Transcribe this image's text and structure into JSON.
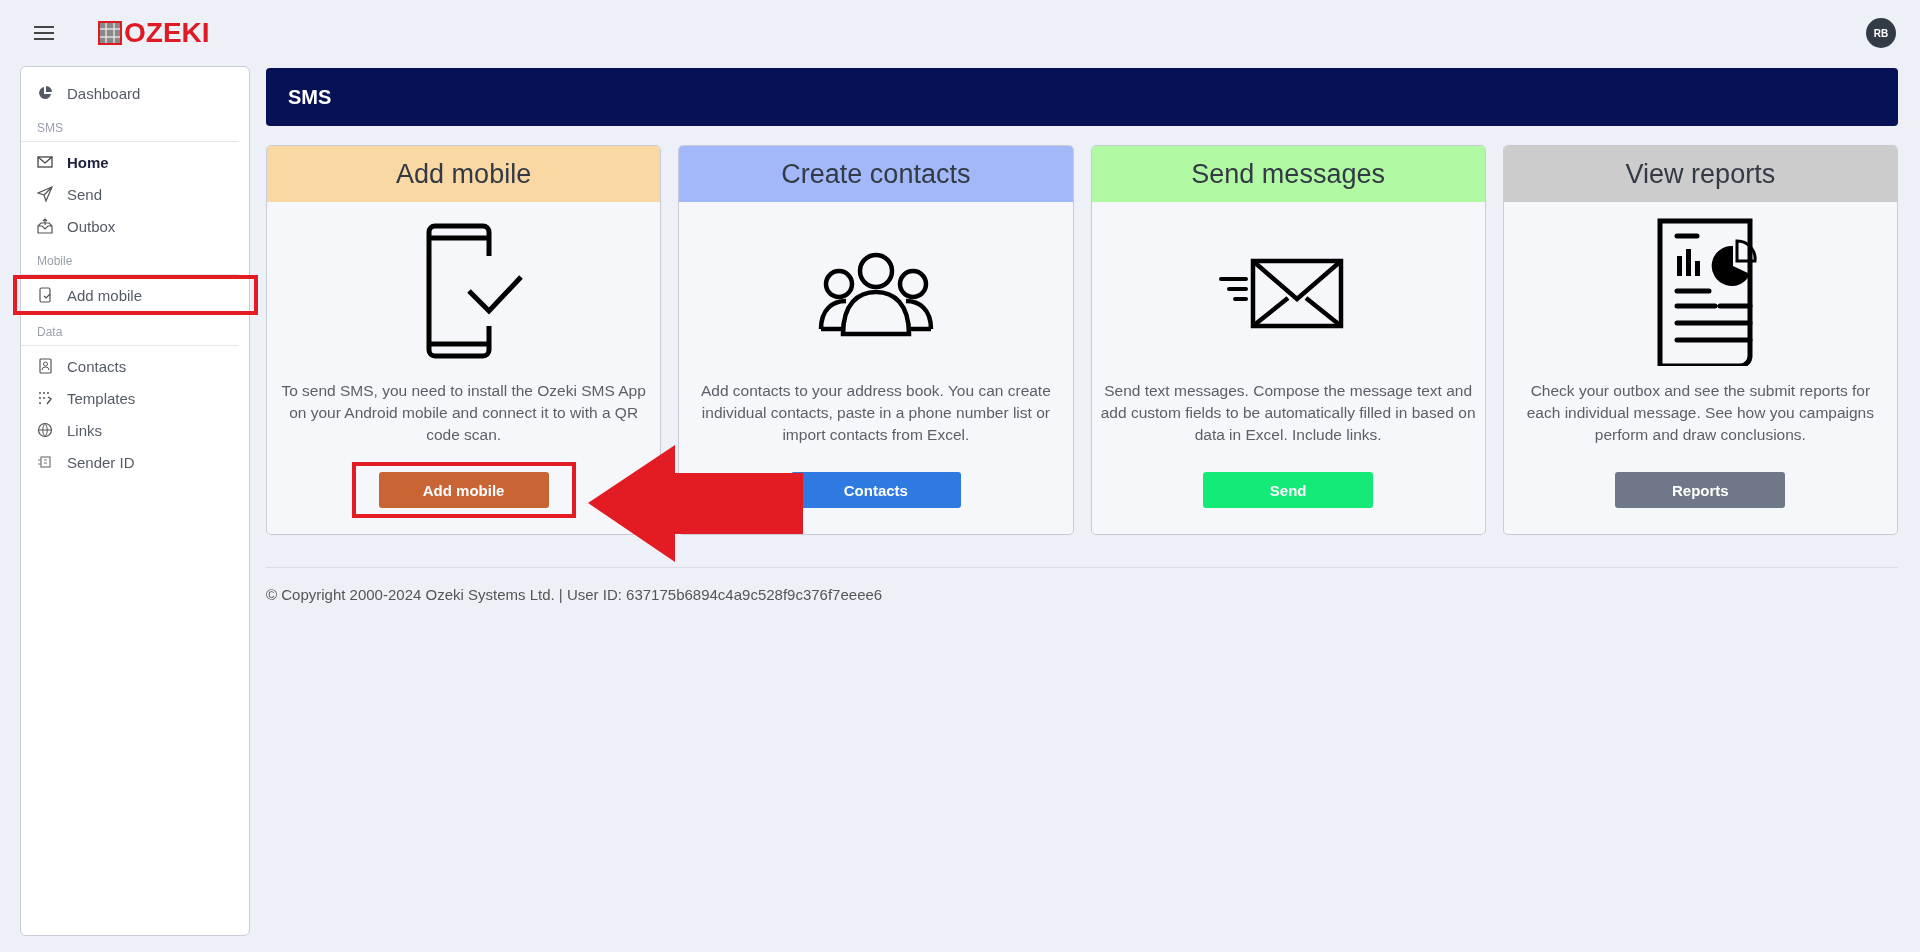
{
  "header": {
    "logo": "OZEKI",
    "avatar": "RB"
  },
  "sidebar": {
    "items": [
      {
        "kind": "link",
        "label": "Dashboard",
        "selected": false,
        "highlighted": false
      },
      {
        "kind": "section",
        "label": "SMS"
      },
      {
        "kind": "link",
        "label": "Home",
        "selected": true,
        "highlighted": false
      },
      {
        "kind": "link",
        "label": "Send",
        "selected": false,
        "highlighted": false
      },
      {
        "kind": "link",
        "label": "Outbox",
        "selected": false,
        "highlighted": false
      },
      {
        "kind": "section",
        "label": "Mobile"
      },
      {
        "kind": "link",
        "label": "Add mobile",
        "selected": false,
        "highlighted": true
      },
      {
        "kind": "section",
        "label": "Data"
      },
      {
        "kind": "link",
        "label": "Contacts",
        "selected": false,
        "highlighted": false
      },
      {
        "kind": "link",
        "label": "Templates",
        "selected": false,
        "highlighted": false
      },
      {
        "kind": "link",
        "label": "Links",
        "selected": false,
        "highlighted": false
      },
      {
        "kind": "link",
        "label": "Sender ID",
        "selected": false,
        "highlighted": false
      }
    ]
  },
  "banner": {
    "title": "SMS"
  },
  "cards": [
    {
      "title": "Add mobile",
      "color": "#f9d8a3",
      "text": "To send SMS, you need to install the Ozeki SMS App on your Android mobile and connect it to with a QR code scan.",
      "button": "Add mobile",
      "highlighted": true
    },
    {
      "title": "Create contacts",
      "color": "#a3b8f9",
      "text": "Add contacts to your address book. You can create individual contacts, paste in a phone number list or import contacts from Excel.",
      "button": "Contacts",
      "highlighted": false
    },
    {
      "title": "Send messages",
      "color": "#b2f9a3",
      "text": "Send text messages. Compose the message text and add custom fields to be automatically filled in based on data in Excel. Include links.",
      "button": "Send",
      "highlighted": false
    },
    {
      "title": "View reports",
      "color": "#cccccc",
      "text": "Check your outbox and see the submit reports for each individual message. See how you campaigns perform and draw conclusions.",
      "button": "Reports",
      "highlighted": false
    }
  ],
  "footer": "© Copyright 2000-2024 Ozeki Systems Ltd. | User ID: 637175b6894c4a9c528f9c376f7eeee6"
}
